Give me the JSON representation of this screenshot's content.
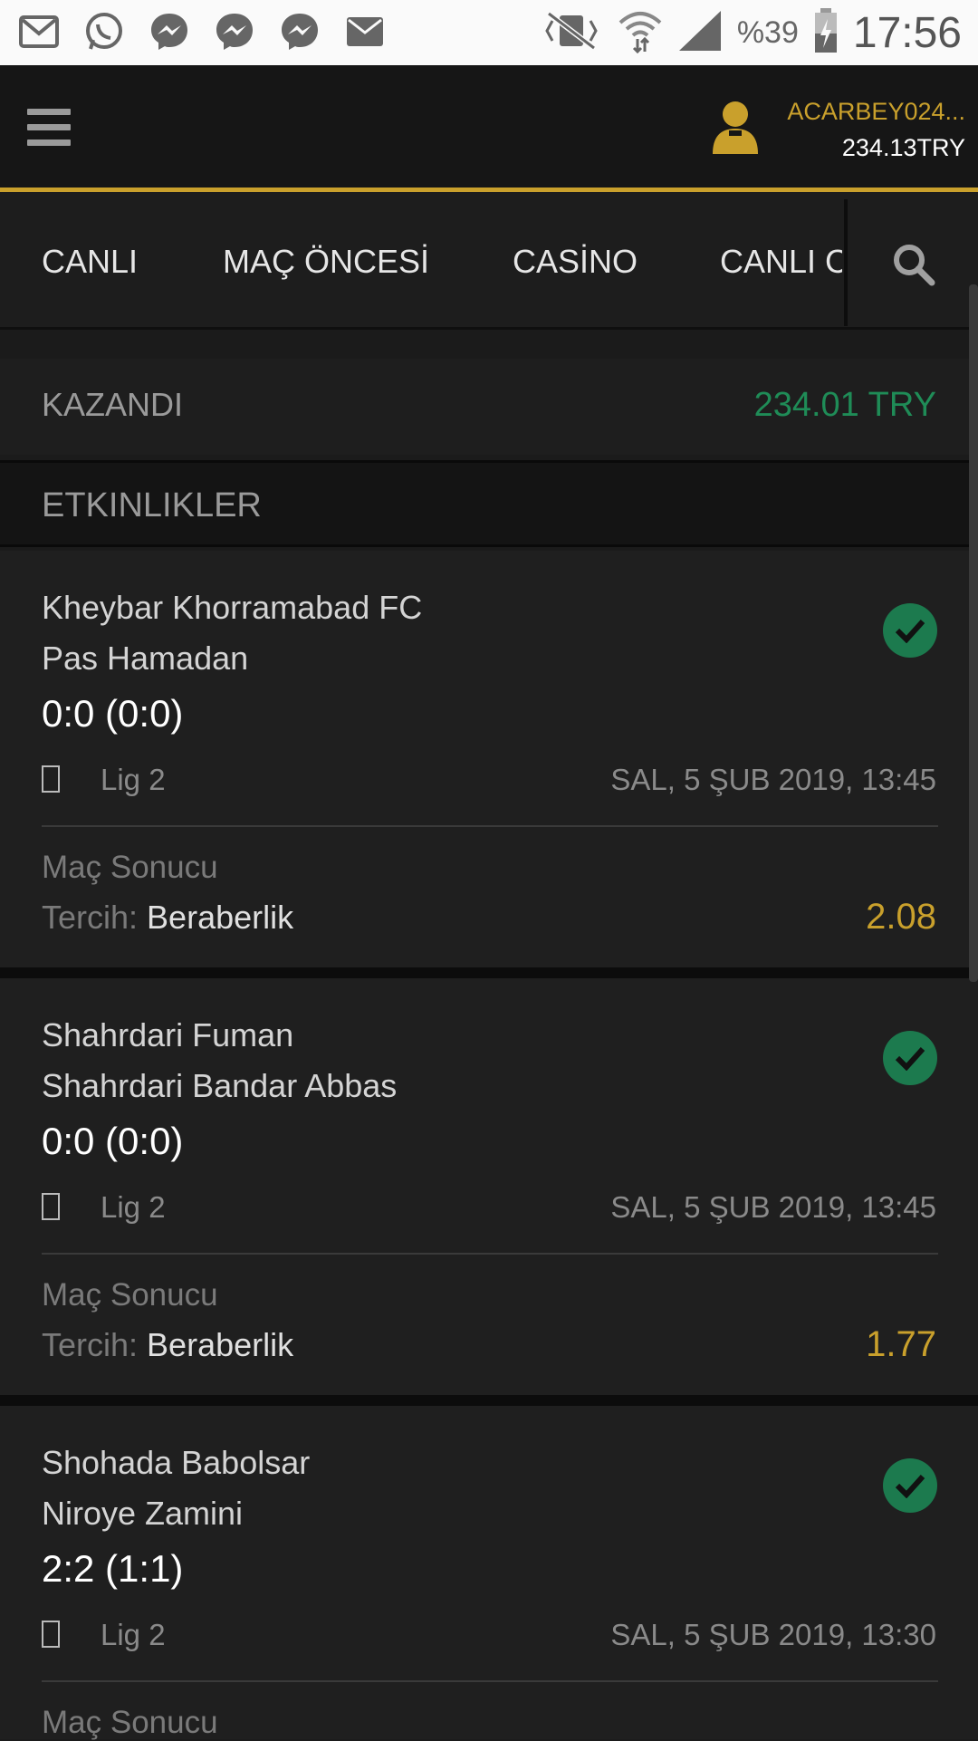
{
  "status_bar": {
    "battery": "%39",
    "time": "17:56",
    "icons": [
      "gmail-icon",
      "whatsapp-icon",
      "messenger-icon",
      "messenger-icon",
      "messenger-icon",
      "mail-icon",
      "vibrate-icon",
      "wifi-icon",
      "signal-icon",
      "battery-icon"
    ]
  },
  "header": {
    "username": "ACARBEY024...",
    "balance": "234.13TRY",
    "accent_color": "#c9a02c"
  },
  "nav": {
    "tabs": [
      "CANLI",
      "MAÇ ÖNCESİ",
      "CASİNO",
      "CANLI C"
    ]
  },
  "summary": {
    "status_label": "KAZANDI",
    "amount": "234.01 TRY",
    "status_color": "#1f8c57"
  },
  "section_title": "ETKINLIKLER",
  "events": [
    {
      "team1": "Kheybar Khorramabad FC",
      "team2": "Pas Hamadan",
      "score": "0:0 (0:0)",
      "league": "Lig 2",
      "datetime": "SAL, 5 ŞUB 2019, 13:45",
      "market": "Maç Sonucu",
      "pref_label": "Tercih:",
      "pref_value": "Beraberlik",
      "odds": "2.08"
    },
    {
      "team1": "Shahrdari Fuman",
      "team2": "Shahrdari Bandar Abbas",
      "score": "0:0 (0:0)",
      "league": "Lig 2",
      "datetime": "SAL, 5 ŞUB 2019, 13:45",
      "market": "Maç Sonucu",
      "pref_label": "Tercih:",
      "pref_value": "Beraberlik",
      "odds": "1.77"
    },
    {
      "team1": "Shohada Babolsar",
      "team2": "Niroye Zamini",
      "score": "2:2 (1:1)",
      "league": "Lig 2",
      "datetime": "SAL, 5 ŞUB 2019, 13:30",
      "market": "Maç Sonucu"
    }
  ]
}
